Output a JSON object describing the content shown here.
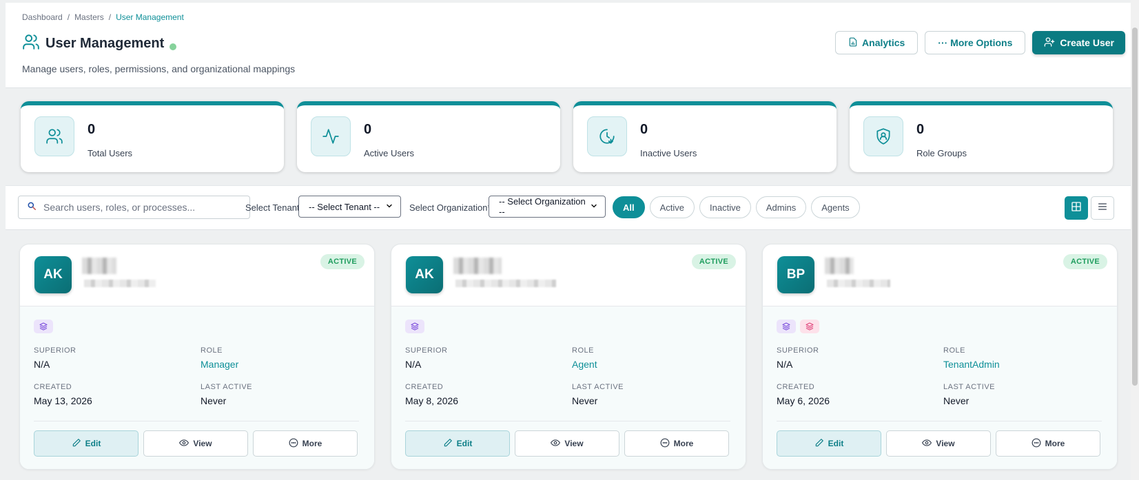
{
  "breadcrumb": [
    "Dashboard",
    "Masters",
    "User Management"
  ],
  "page": {
    "title": "User Management",
    "subtitle": "Manage users, roles, permissions, and organizational mappings"
  },
  "header_actions": {
    "analytics": "Analytics",
    "more_options": "··· More Options",
    "create_user": "Create User"
  },
  "stats": [
    {
      "value": "0",
      "label": "Total Users",
      "icon": "users-icon"
    },
    {
      "value": "0",
      "label": "Active Users",
      "icon": "activity-icon"
    },
    {
      "value": "0",
      "label": "Inactive Users",
      "icon": "clock-icon"
    },
    {
      "value": "0",
      "label": "Role Groups",
      "icon": "shield-user-icon"
    }
  ],
  "filters": {
    "search_placeholder": "Search users, roles, or processes...",
    "tenant_label": "Select Tenant",
    "tenant_value": "-- Select Tenant --",
    "org_label": "Select Organization*",
    "org_value": "-- Select Organization --",
    "chips": [
      "All",
      "Active",
      "Inactive",
      "Admins",
      "Agents"
    ],
    "active_chip": "All"
  },
  "cards": [
    {
      "initials": "AK",
      "status": "ACTIVE",
      "superior_label": "SUPERIOR",
      "superior": "N/A",
      "role_label": "ROLE",
      "role": "Manager",
      "created_label": "CREATED",
      "created": "May 13, 2026",
      "last_active_label": "LAST ACTIVE",
      "last_active": "Never",
      "tags": [
        "purple"
      ]
    },
    {
      "initials": "AK",
      "status": "ACTIVE",
      "superior_label": "SUPERIOR",
      "superior": "N/A",
      "role_label": "ROLE",
      "role": "Agent",
      "created_label": "CREATED",
      "created": "May 8, 2026",
      "last_active_label": "LAST ACTIVE",
      "last_active": "Never",
      "tags": [
        "purple"
      ]
    },
    {
      "initials": "BP",
      "status": "ACTIVE",
      "superior_label": "SUPERIOR",
      "superior": "N/A",
      "role_label": "ROLE",
      "role": "TenantAdmin",
      "created_label": "CREATED",
      "created": "May 6, 2026",
      "last_active_label": "LAST ACTIVE",
      "last_active": "Never",
      "tags": [
        "purple",
        "pink"
      ]
    }
  ],
  "card_actions": {
    "edit": "Edit",
    "view": "View",
    "more": "More"
  },
  "colors": {
    "accent": "#0e8f98",
    "active_badge": "#1f9d5e",
    "live_dot": "#86d29b"
  }
}
